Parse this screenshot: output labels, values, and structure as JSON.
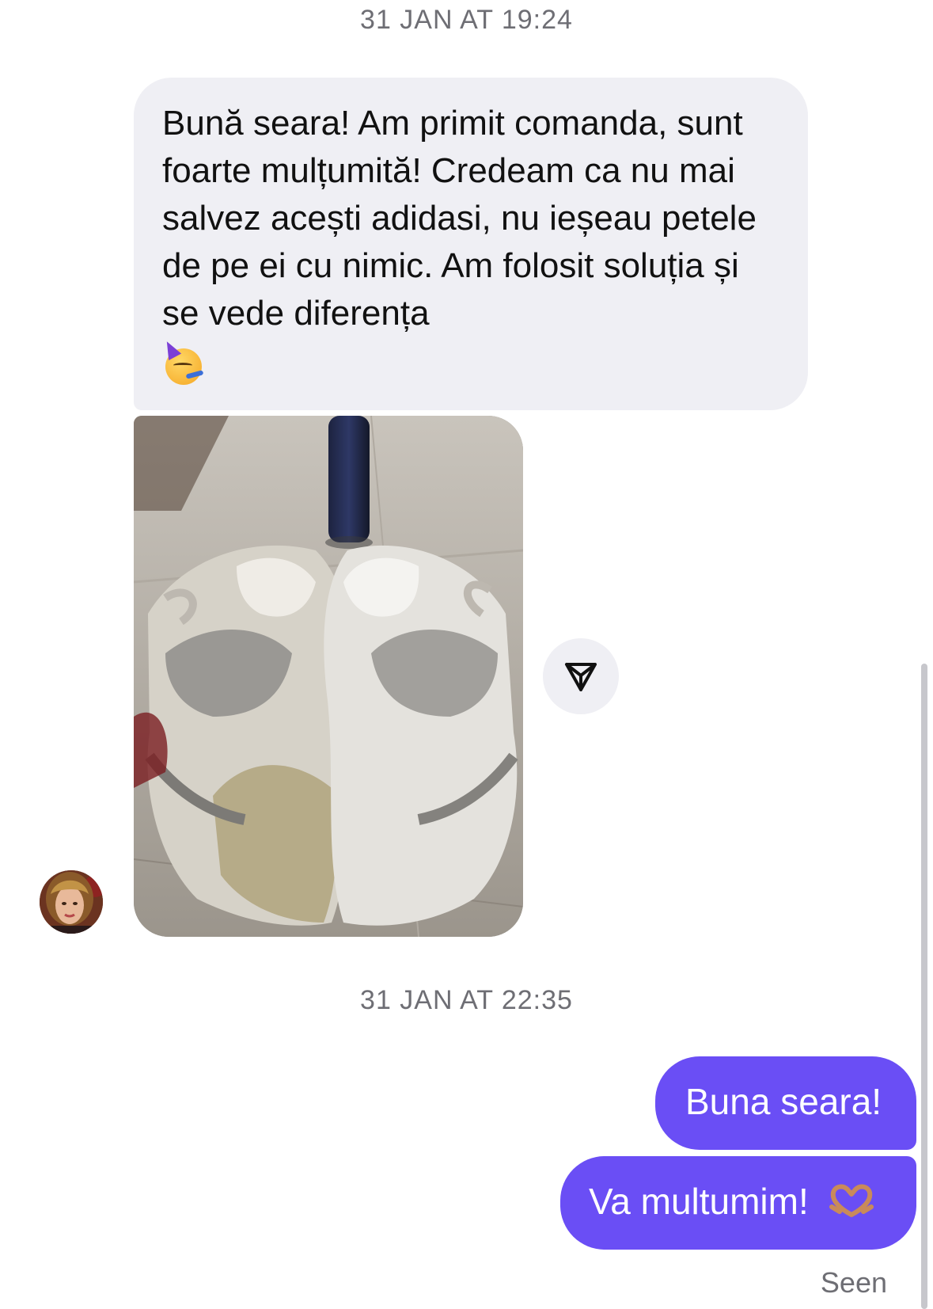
{
  "conversation": {
    "timestamp_1": "31 JAN AT 19:24",
    "incoming_message": {
      "text": "Bună seara! Am primit comanda, sunt foarte mulțumită! Credeam ca nu mai salvez acești adidasi, nu ieșeau petele de pe ei cu nimic. Am folosit soluția și se vede diferența",
      "emoji": "partying-face-emoji"
    },
    "incoming_photo": {
      "subject": "photo of worn white sneakers with a dark bottle of cleaning solution"
    },
    "share_button": {
      "icon": "send-icon"
    },
    "sender_avatar": {
      "icon": "avatar-woman"
    },
    "timestamp_2": "31 JAN AT 22:35",
    "outgoing_messages": [
      {
        "text": "Buna seara!"
      },
      {
        "text": "Va multumim!",
        "emoji": "heart-hands-emoji"
      }
    ],
    "status": "Seen"
  },
  "colors": {
    "incoming_bubble": "#efeff4",
    "outgoing_bubble": "#6a4ef5",
    "timestamp_text": "#6e6e74"
  }
}
